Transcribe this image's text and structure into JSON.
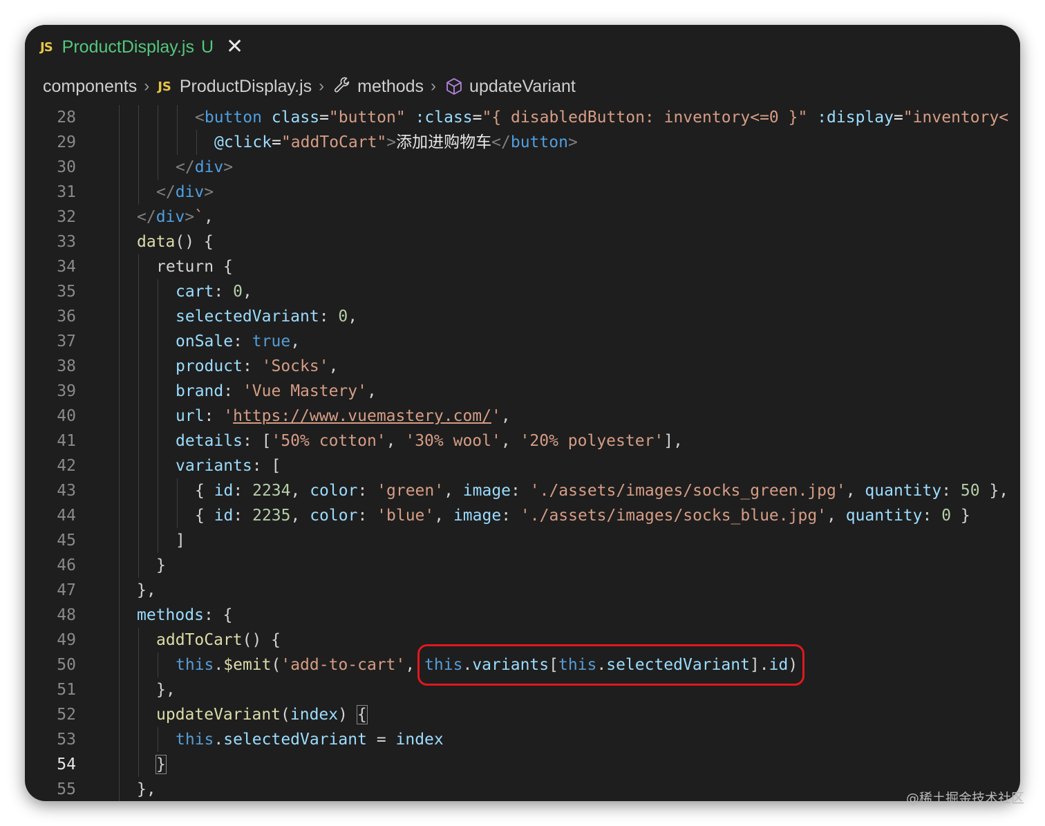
{
  "tab": {
    "icon": "JS",
    "filename": "ProductDisplay.js",
    "status": "U",
    "close": "✕"
  },
  "breadcrumb": {
    "items": [
      "components",
      "ProductDisplay.js",
      "methods",
      "updateVariant"
    ],
    "js_badge": "JS",
    "separator": "›"
  },
  "editor": {
    "active_line": 54,
    "line_numbers": [
      "28",
      "29",
      "30",
      "31",
      "32",
      "33",
      "34",
      "35",
      "36",
      "37",
      "38",
      "39",
      "40",
      "41",
      "42",
      "43",
      "44",
      "45",
      "46",
      "47",
      "48",
      "49",
      "50",
      "51",
      "52",
      "53",
      "54",
      "55"
    ],
    "lines": [
      [
        [
          "t-tag",
          "<"
        ],
        [
          "t-el",
          "button"
        ],
        [
          "t-text",
          " "
        ],
        [
          "t-attr",
          "class"
        ],
        [
          "t-text",
          "="
        ],
        [
          "t-str",
          "\"button\""
        ],
        [
          "t-text",
          " "
        ],
        [
          "t-attr",
          ":class"
        ],
        [
          "t-text",
          "="
        ],
        [
          "t-str",
          "\"{ disabledButton: inventory<=0 }\""
        ],
        [
          "t-text",
          " "
        ],
        [
          "t-attr",
          ":display"
        ],
        [
          "t-text",
          "="
        ],
        [
          "t-str",
          "\"inventory<"
        ]
      ],
      [
        [
          "t-attr",
          "@click"
        ],
        [
          "t-text",
          "="
        ],
        [
          "t-str",
          "\"addToCart\""
        ],
        [
          "t-tag",
          ">"
        ],
        [
          "t-text",
          "添加进购物车"
        ],
        [
          "t-tag",
          "</"
        ],
        [
          "t-el",
          "button"
        ],
        [
          "t-tag",
          ">"
        ]
      ],
      [
        [
          "t-tag",
          "</"
        ],
        [
          "t-el",
          "div"
        ],
        [
          "t-tag",
          ">"
        ]
      ],
      [
        [
          "t-tag",
          "</"
        ],
        [
          "t-el",
          "div"
        ],
        [
          "t-tag",
          ">"
        ]
      ],
      [
        [
          "t-tag",
          "</"
        ],
        [
          "t-el",
          "div"
        ],
        [
          "t-tag",
          ">"
        ],
        [
          "t-str",
          "`"
        ],
        [
          "t-punct",
          ","
        ]
      ],
      [
        [
          "t-func",
          "data"
        ],
        [
          "t-punct",
          "() {"
        ]
      ],
      [
        [
          "t-kw",
          "return"
        ],
        [
          "t-punct",
          " {"
        ]
      ],
      [
        [
          "t-prop",
          "cart"
        ],
        [
          "t-punct",
          ": "
        ],
        [
          "t-num",
          "0"
        ],
        [
          "t-punct",
          ","
        ]
      ],
      [
        [
          "t-prop",
          "selectedVariant"
        ],
        [
          "t-punct",
          ": "
        ],
        [
          "t-num",
          "0"
        ],
        [
          "t-punct",
          ","
        ]
      ],
      [
        [
          "t-prop",
          "onSale"
        ],
        [
          "t-punct",
          ": "
        ],
        [
          "t-bool",
          "true"
        ],
        [
          "t-punct",
          ","
        ]
      ],
      [
        [
          "t-prop",
          "product"
        ],
        [
          "t-punct",
          ": "
        ],
        [
          "t-str",
          "'Socks'"
        ],
        [
          "t-punct",
          ","
        ]
      ],
      [
        [
          "t-prop",
          "brand"
        ],
        [
          "t-punct",
          ": "
        ],
        [
          "t-str",
          "'Vue Mastery'"
        ],
        [
          "t-punct",
          ","
        ]
      ],
      [
        [
          "t-prop",
          "url"
        ],
        [
          "t-punct",
          ": "
        ],
        [
          "t-str",
          "'"
        ],
        [
          "t-url",
          "https://www.vuemastery.com/"
        ],
        [
          "t-str",
          "'"
        ],
        [
          "t-punct",
          ","
        ]
      ],
      [
        [
          "t-prop",
          "details"
        ],
        [
          "t-punct",
          ": ["
        ],
        [
          "t-str",
          "'50% cotton'"
        ],
        [
          "t-punct",
          ", "
        ],
        [
          "t-str",
          "'30% wool'"
        ],
        [
          "t-punct",
          ", "
        ],
        [
          "t-str",
          "'20% polyester'"
        ],
        [
          "t-punct",
          "],"
        ]
      ],
      [
        [
          "t-prop",
          "variants"
        ],
        [
          "t-punct",
          ": ["
        ]
      ],
      [
        [
          "t-punct",
          "{ "
        ],
        [
          "t-prop",
          "id"
        ],
        [
          "t-punct",
          ": "
        ],
        [
          "t-num",
          "2234"
        ],
        [
          "t-punct",
          ", "
        ],
        [
          "t-prop",
          "color"
        ],
        [
          "t-punct",
          ": "
        ],
        [
          "t-str",
          "'green'"
        ],
        [
          "t-punct",
          ", "
        ],
        [
          "t-prop",
          "image"
        ],
        [
          "t-punct",
          ": "
        ],
        [
          "t-str",
          "'./assets/images/socks_green.jpg'"
        ],
        [
          "t-punct",
          ", "
        ],
        [
          "t-prop",
          "quantity"
        ],
        [
          "t-punct",
          ": "
        ],
        [
          "t-num",
          "50"
        ],
        [
          "t-punct",
          " },"
        ]
      ],
      [
        [
          "t-punct",
          "{ "
        ],
        [
          "t-prop",
          "id"
        ],
        [
          "t-punct",
          ": "
        ],
        [
          "t-num",
          "2235"
        ],
        [
          "t-punct",
          ", "
        ],
        [
          "t-prop",
          "color"
        ],
        [
          "t-punct",
          ": "
        ],
        [
          "t-str",
          "'blue'"
        ],
        [
          "t-punct",
          ", "
        ],
        [
          "t-prop",
          "image"
        ],
        [
          "t-punct",
          ": "
        ],
        [
          "t-str",
          "'./assets/images/socks_blue.jpg'"
        ],
        [
          "t-punct",
          ", "
        ],
        [
          "t-prop",
          "quantity"
        ],
        [
          "t-punct",
          ": "
        ],
        [
          "t-num",
          "0"
        ],
        [
          "t-punct",
          " }"
        ]
      ],
      [
        [
          "t-punct",
          "]"
        ]
      ],
      [
        [
          "t-punct",
          "}"
        ]
      ],
      [
        [
          "t-punct",
          "},"
        ]
      ],
      [
        [
          "t-prop",
          "methods"
        ],
        [
          "t-punct",
          ": {"
        ]
      ],
      [
        [
          "t-func",
          "addToCart"
        ],
        [
          "t-punct",
          "() {"
        ]
      ],
      [
        [
          "t-this",
          "this"
        ],
        [
          "t-punct",
          "."
        ],
        [
          "t-func",
          "$emit"
        ],
        [
          "t-punct",
          "("
        ],
        [
          "t-str",
          "'add-to-cart'"
        ],
        [
          "t-punct",
          ", "
        ],
        [
          "t-this",
          "this"
        ],
        [
          "t-punct",
          "."
        ],
        [
          "t-prop",
          "variants"
        ],
        [
          "t-punct",
          "["
        ],
        [
          "t-this",
          "this"
        ],
        [
          "t-punct",
          "."
        ],
        [
          "t-prop",
          "selectedVariant"
        ],
        [
          "t-punct",
          "]."
        ],
        [
          "t-prop",
          "id"
        ],
        [
          "t-punct",
          ")"
        ]
      ],
      [
        [
          "t-punct",
          "},"
        ]
      ],
      [
        [
          "t-func",
          "updateVariant"
        ],
        [
          "t-punct",
          "("
        ],
        [
          "t-prop",
          "index"
        ],
        [
          "t-punct",
          ") "
        ],
        [
          "t-bracket",
          "{"
        ]
      ],
      [
        [
          "t-this",
          "this"
        ],
        [
          "t-punct",
          "."
        ],
        [
          "t-prop",
          "selectedVariant"
        ],
        [
          "t-punct",
          " = "
        ],
        [
          "t-prop",
          "index"
        ]
      ],
      [
        [
          "t-bracket",
          "}"
        ]
      ],
      [
        [
          "t-punct",
          "},"
        ]
      ]
    ]
  },
  "highlight": {
    "text": "this.variants[this.selectedVariant].id)",
    "color": "#e0181e"
  },
  "watermark": "@稀土掘金技术社区"
}
